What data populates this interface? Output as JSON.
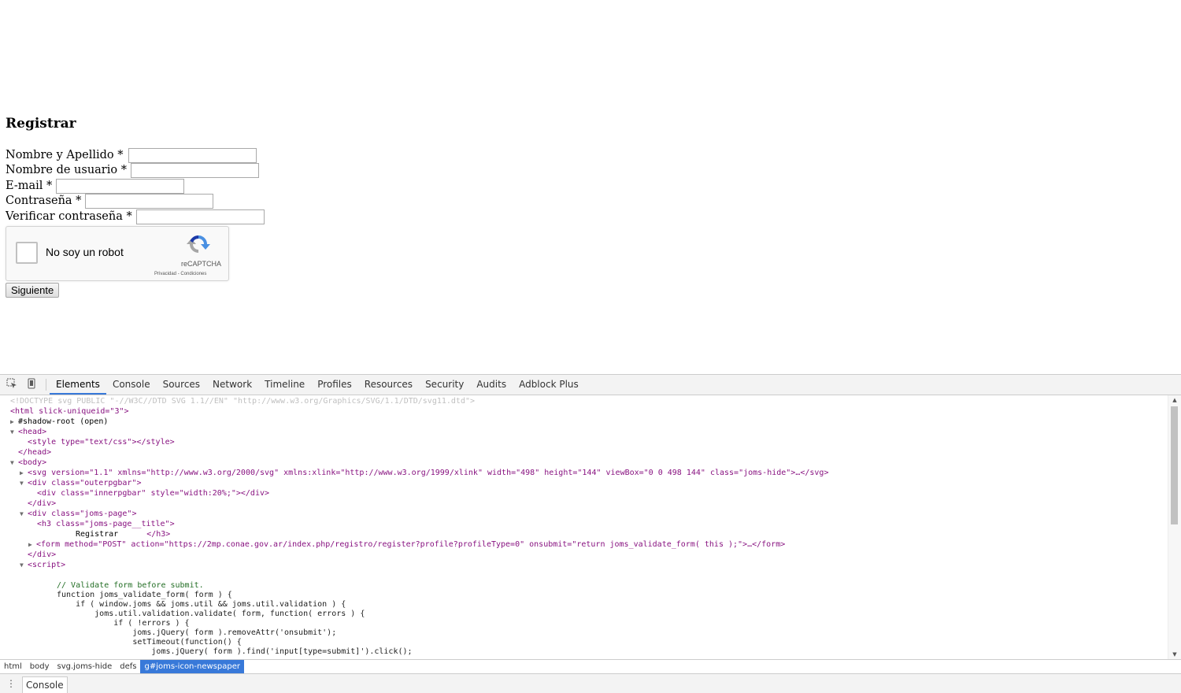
{
  "page": {
    "title": "Registrar",
    "fields": [
      {
        "label": "Nombre y Apellido *",
        "value": ""
      },
      {
        "label": "Nombre de usuario *",
        "value": ""
      },
      {
        "label": "E-mail *",
        "value": ""
      },
      {
        "label": "Contraseña *",
        "value": ""
      },
      {
        "label": "Verificar contraseña *",
        "value": ""
      }
    ],
    "captcha": {
      "label": "No soy un robot",
      "brand": "reCAPTCHA",
      "privacy": "Privacidad",
      "terms": "Condiciones"
    },
    "submit_label": "Siguiente"
  },
  "devtools": {
    "tabs": [
      "Elements",
      "Console",
      "Sources",
      "Network",
      "Timeline",
      "Profiles",
      "Resources",
      "Security",
      "Audits",
      "Adblock Plus"
    ],
    "active_tab": "Elements",
    "breadcrumbs": [
      "html",
      "body",
      "svg.joms-hide",
      "defs",
      "g#joms-icon-newspaper"
    ],
    "selected_breadcrumb": "g#joms-icon-newspaper",
    "drawer_tab": "Console",
    "dom": {
      "doctype": "<!DOCTYPE svg PUBLIC \"-//W3C//DTD SVG 1.1//EN\" \"http://www.w3.org/Graphics/SVG/1.1/DTD/svg11.dtd\">",
      "html_open": "<html slick-uniqueid=\"3\">",
      "shadow_root": "#shadow-root (open)",
      "head_open": "<head>",
      "style_line": "<style type=\"text/css\"></style>",
      "head_close": "</head>",
      "body_open": "<body>",
      "svg_line": "<svg version=\"1.1\" xmlns=\"http://www.w3.org/2000/svg\" xmlns:xlink=\"http://www.w3.org/1999/xlink\" width=\"498\" height=\"144\" viewBox=\"0 0 498 144\" class=\"joms-hide\">…</svg>",
      "outerpgbar_open": "<div class=\"outerpgbar\">",
      "innerpgbar_line": "<div class=\"innerpgbar\" style=\"width:20%;\"></div>",
      "div_close": "</div>",
      "joms_page_open": "<div class=\"joms-page\">",
      "h3_open": "<h3 class=\"joms-page__title\">",
      "h3_text": "Registrar",
      "h3_close": "</h3>",
      "form_line": "<form method=\"POST\" action=\"https://2mp.conae.gov.ar/index.php/registro/register?profile?profileType=0\" onsubmit=\"return joms_validate_form( this );\">…</form>",
      "div_close2": "</div>",
      "script_open": "<script>",
      "code": [
        "// Validate form before submit.",
        "function joms_validate_form( form ) {",
        "    if ( window.joms && joms.util && joms.util.validation ) {",
        "        joms.util.validation.validate( form, function( errors ) {",
        "            if ( !errors ) {",
        "                joms.jQuery( form ).removeAttr('onsubmit');",
        "                setTimeout(function() {",
        "                    joms.jQuery( form ).find('input[type=submit]').click();"
      ]
    }
  }
}
